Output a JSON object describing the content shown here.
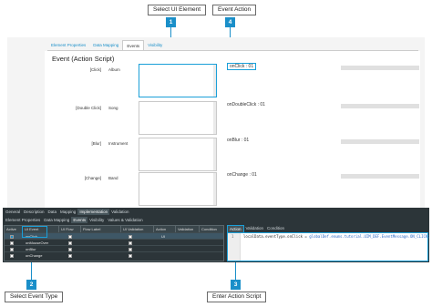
{
  "callouts": [
    {
      "number": "1",
      "label": "Select UI Element"
    },
    {
      "number": "4",
      "label": "Event Action"
    },
    {
      "number": "2",
      "label": "Select Event Type"
    },
    {
      "number": "3",
      "label": "Enter Action Script"
    }
  ],
  "top_tabs": [
    "Element Properties",
    "Data Mapping",
    "Events",
    "Visibility"
  ],
  "active_top_tab": "Events",
  "section_title": "Event (Action Script)",
  "event_rows": [
    {
      "event": "[Click]",
      "ui": "Album",
      "action": "onClick : 01"
    },
    {
      "event": "[Double Click]",
      "ui": "Song",
      "action": "onDoubleClick : 01"
    },
    {
      "event": "[Blur]",
      "ui": "Instrument",
      "action": "onBlur : 01"
    },
    {
      "event": "[Change]",
      "ui": "Band",
      "action": "onChange : 01"
    }
  ],
  "main_tabs": [
    "General",
    "Description",
    "Data",
    "Mapping",
    "Implementation",
    "Validation"
  ],
  "active_main_tab": "Implementation",
  "sub_tabs": [
    "Element Properties",
    "Data Mapping",
    "Events",
    "Visibility",
    "Values & Validation"
  ],
  "active_sub_tab": "Events",
  "grid_headers": [
    "Active",
    "UI Event",
    "UI Flow",
    "Flow Label",
    "UI Validation",
    "Action",
    "Validation",
    "Condition"
  ],
  "grid_rows": [
    {
      "event": "onClick",
      "action": "UI"
    },
    {
      "event": "onMouseOver",
      "action": ""
    },
    {
      "event": "onBlur",
      "action": ""
    },
    {
      "event": "onChange",
      "action": ""
    }
  ],
  "right_tabs": [
    "Action",
    "Validation",
    "Condition"
  ],
  "active_right_tab": "Action",
  "editor": {
    "line_number": "1",
    "code_prefix": "localData.eventType.onClick = ",
    "code_rest": "globalDef.enums.tutorial.UIM_DEF.EventMessage.ON_CLICK;"
  },
  "colors": {
    "accent": "#1a9fd8",
    "badge": "#1a8fc9",
    "dark_panel": "#2c3539"
  }
}
